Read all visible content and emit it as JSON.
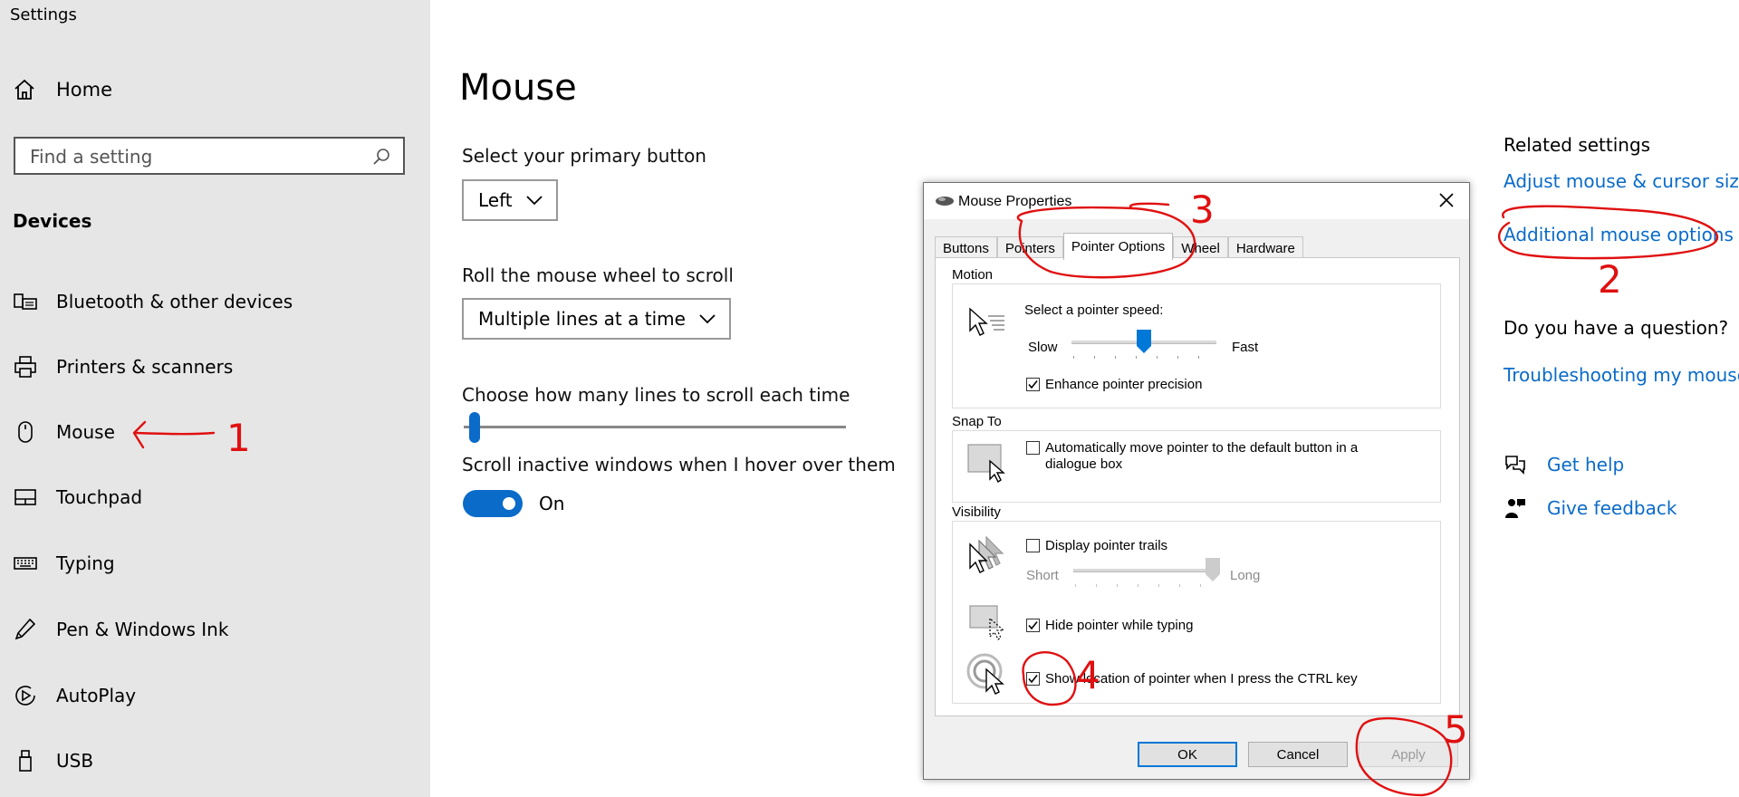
{
  "app": {
    "title": "Settings"
  },
  "sidebar": {
    "home_label": "Home",
    "search_placeholder": "Find a setting",
    "section_title": "Devices",
    "items": [
      {
        "label": "Bluetooth & other devices",
        "icon": "bluetooth-devices-icon"
      },
      {
        "label": "Printers & scanners",
        "icon": "printer-icon"
      },
      {
        "label": "Mouse",
        "icon": "mouse-icon"
      },
      {
        "label": "Touchpad",
        "icon": "touchpad-icon"
      },
      {
        "label": "Typing",
        "icon": "keyboard-icon"
      },
      {
        "label": "Pen & Windows Ink",
        "icon": "pen-icon"
      },
      {
        "label": "AutoPlay",
        "icon": "autoplay-icon"
      },
      {
        "label": "USB",
        "icon": "usb-icon"
      }
    ]
  },
  "main": {
    "title": "Mouse",
    "primary_button_label": "Select your primary button",
    "primary_button_value": "Left",
    "scroll_label": "Roll the mouse wheel to scroll",
    "scroll_value": "Multiple lines at a time",
    "lines_label": "Choose how many lines to scroll each time",
    "lines_value_fraction": 0.03,
    "inactive_label": "Scroll inactive windows when I hover over them",
    "inactive_state": "On"
  },
  "related": {
    "title": "Related settings",
    "link_adjust": "Adjust mouse & cursor size",
    "link_additional": "Additional mouse options",
    "question_title": "Do you have a question?",
    "link_troubleshoot": "Troubleshooting my mouse",
    "get_help": "Get help",
    "give_feedback": "Give feedback"
  },
  "dialog": {
    "title": "Mouse Properties",
    "tabs": [
      "Buttons",
      "Pointers",
      "Pointer Options",
      "Wheel",
      "Hardware"
    ],
    "active_tab": "Pointer Options",
    "motion": {
      "group": "Motion",
      "speed_label": "Select a pointer speed:",
      "slow": "Slow",
      "fast": "Fast",
      "speed_fraction": 0.5,
      "precision_label": "Enhance pointer precision",
      "precision_checked": true
    },
    "snap": {
      "group": "Snap To",
      "label_line1": "Automatically move pointer to the default button in a",
      "label_line2": "dialogue box",
      "checked": false
    },
    "visibility": {
      "group": "Visibility",
      "trails_label": "Display pointer trails",
      "trails_checked": false,
      "short": "Short",
      "long": "Long",
      "hide_label": "Hide pointer while typing",
      "hide_checked": true,
      "show_label": "Show location of pointer when I press the CTRL key",
      "show_checked": true
    },
    "buttons": {
      "ok": "OK",
      "cancel": "Cancel",
      "apply": "Apply"
    }
  },
  "annotations": {
    "n1": "1",
    "n2": "2",
    "n3": "3",
    "n4": "4",
    "n5": "5"
  },
  "colors": {
    "accent": "#0a6bc9",
    "annotation": "#e01010",
    "sidebar_bg": "#e6e6e6"
  }
}
